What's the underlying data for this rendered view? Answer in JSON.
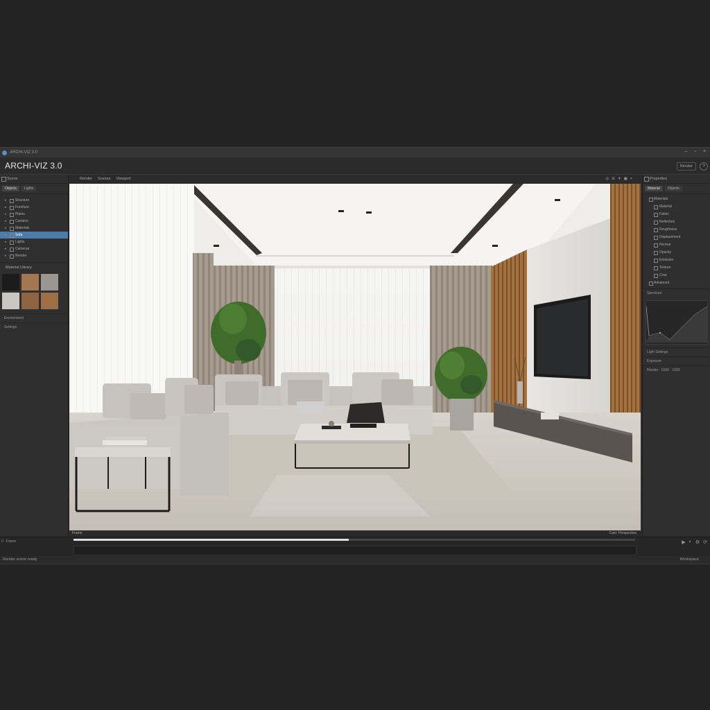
{
  "window": {
    "small_title": "ARCHI-VIZ 3.0",
    "brand": "ARCHI-VIZ 3.0",
    "controls": [
      "–",
      "▫",
      "×"
    ],
    "header_button": "Render",
    "header_circle": "?"
  },
  "left_panel": {
    "head": "Scene",
    "tabs": [
      "Objects",
      "Lights"
    ],
    "outliner": [
      {
        "label": "Structure",
        "selected": false
      },
      {
        "label": "Furniture",
        "selected": false
      },
      {
        "label": "Plants",
        "selected": false
      },
      {
        "label": "Curtains",
        "selected": false
      },
      {
        "label": "Materials",
        "selected": false
      },
      {
        "label": "Sofa",
        "selected": true
      },
      {
        "label": "Lights",
        "selected": false
      },
      {
        "label": "Cameras",
        "selected": false
      },
      {
        "label": "Render",
        "selected": false
      }
    ],
    "materials_title": "Material Library",
    "swatch_colors": [
      "#1c1c1c",
      "#a47752",
      "#9a9793",
      "#c9c7c2",
      "#8f633f",
      "#9e6f45"
    ],
    "sub_rows": [
      "Environment",
      "Settings"
    ]
  },
  "viewport": {
    "menu": [
      "Render",
      "Scenes",
      "Viewport"
    ],
    "tools": [
      "◎",
      "☰",
      "✦",
      "▣",
      "×"
    ],
    "status_left": "Frame",
    "status_right": "Cam: Perspective"
  },
  "right_panel": {
    "head": "Properties",
    "tabs": [
      "Material",
      "Objects"
    ],
    "items": [
      {
        "label": "Materials",
        "head": true
      },
      {
        "label": "Material"
      },
      {
        "label": "Fabric"
      },
      {
        "label": "Reflection"
      },
      {
        "label": "Roughness"
      },
      {
        "label": "Displacement"
      },
      {
        "label": "Normal"
      },
      {
        "label": "Opacity"
      },
      {
        "label": "Emission"
      },
      {
        "label": "Texture"
      },
      {
        "label": "Coat"
      },
      {
        "label": "Advanced",
        "head": true
      }
    ],
    "graph_title": "Spectrum",
    "sections": [
      "Light Settings",
      "Exposure",
      "Render · 0100 · 1920"
    ]
  },
  "timeline": {
    "left_labels": [
      "0",
      "Frame"
    ],
    "right_icons": [
      "▶",
      "◐",
      "⚙",
      "⟳"
    ],
    "progress_fraction": 0.49
  },
  "statusbar": {
    "left": "Render scene ready",
    "right": "Workspace"
  }
}
